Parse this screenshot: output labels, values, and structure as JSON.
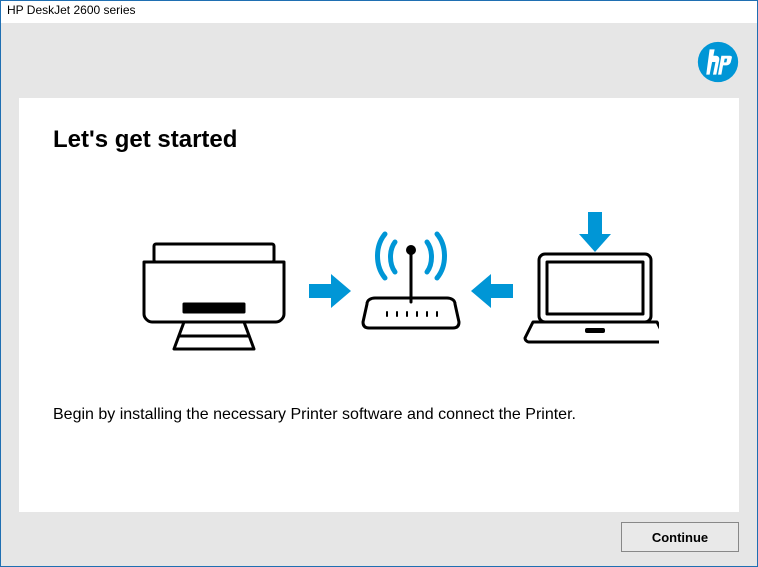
{
  "window": {
    "title": "HP DeskJet 2600 series"
  },
  "brand": {
    "name": "hp",
    "color": "#0096D6"
  },
  "content": {
    "heading": "Let's get started",
    "description": "Begin by installing the necessary Printer software and connect the Printer."
  },
  "illustration": {
    "printer_icon": "printer",
    "router_icon": "wireless-router",
    "laptop_icon": "laptop",
    "arrow_color": "#0096D6"
  },
  "buttons": {
    "continue": "Continue"
  }
}
